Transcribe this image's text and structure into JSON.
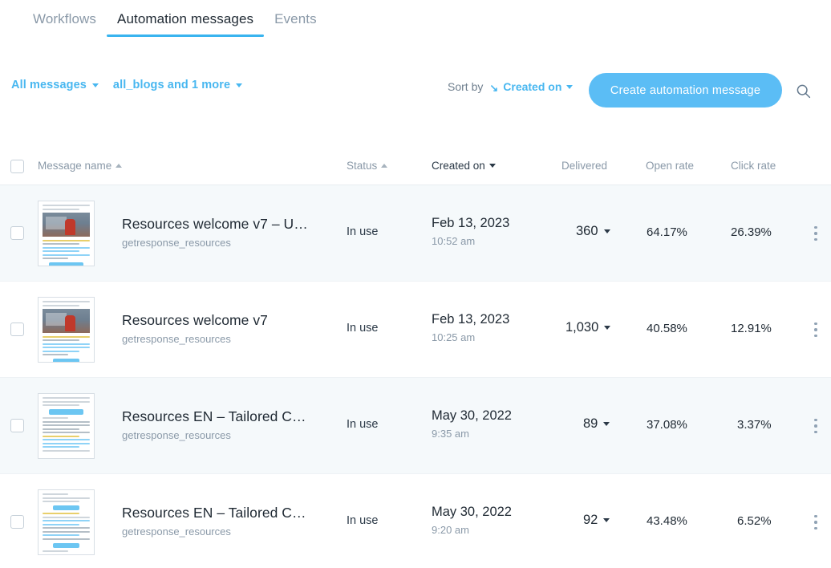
{
  "tabs": [
    {
      "label": "Workflows",
      "active": false
    },
    {
      "label": "Automation messages",
      "active": true
    },
    {
      "label": "Events",
      "active": false
    }
  ],
  "toolbar": {
    "filter_messages": "All messages",
    "filter_lists": "all_blogs and 1 more",
    "sort_label": "Sort by",
    "sort_value": "Created on",
    "sort_direction_icon": "arrow-down-right-icon",
    "create_button": "Create automation message",
    "search_icon": "search-icon"
  },
  "table": {
    "columns": {
      "name": "Message name",
      "status": "Status",
      "created": "Created on",
      "delivered": "Delivered",
      "open_rate": "Open rate",
      "click_rate": "Click rate"
    },
    "rows": [
      {
        "name": "Resources welcome v7 – U…",
        "list": "getresponse_resources",
        "status": "In use",
        "date": "Feb 13, 2023",
        "time": "10:52 am",
        "delivered": "360",
        "open_rate": "64.17%",
        "click_rate": "26.39%"
      },
      {
        "name": "Resources welcome v7",
        "list": "getresponse_resources",
        "status": "In use",
        "date": "Feb 13, 2023",
        "time": "10:25 am",
        "delivered": "1,030",
        "open_rate": "40.58%",
        "click_rate": "12.91%"
      },
      {
        "name": "Resources EN – Tailored C…",
        "list": "getresponse_resources",
        "status": "In use",
        "date": "May 30, 2022",
        "time": "9:35 am",
        "delivered": "89",
        "open_rate": "37.08%",
        "click_rate": "3.37%"
      },
      {
        "name": "Resources EN – Tailored C…",
        "list": "getresponse_resources",
        "status": "In use",
        "date": "May 30, 2022",
        "time": "9:20 am",
        "delivered": "92",
        "open_rate": "43.48%",
        "click_rate": "6.52%"
      }
    ]
  },
  "colors": {
    "accent": "#48b7f0",
    "cta": "#5bbdf5",
    "tab_underline": "#39b4ef",
    "row_alt": "#f5f9fb",
    "text_primary": "#1f2933",
    "text_muted": "#8a99a8"
  }
}
